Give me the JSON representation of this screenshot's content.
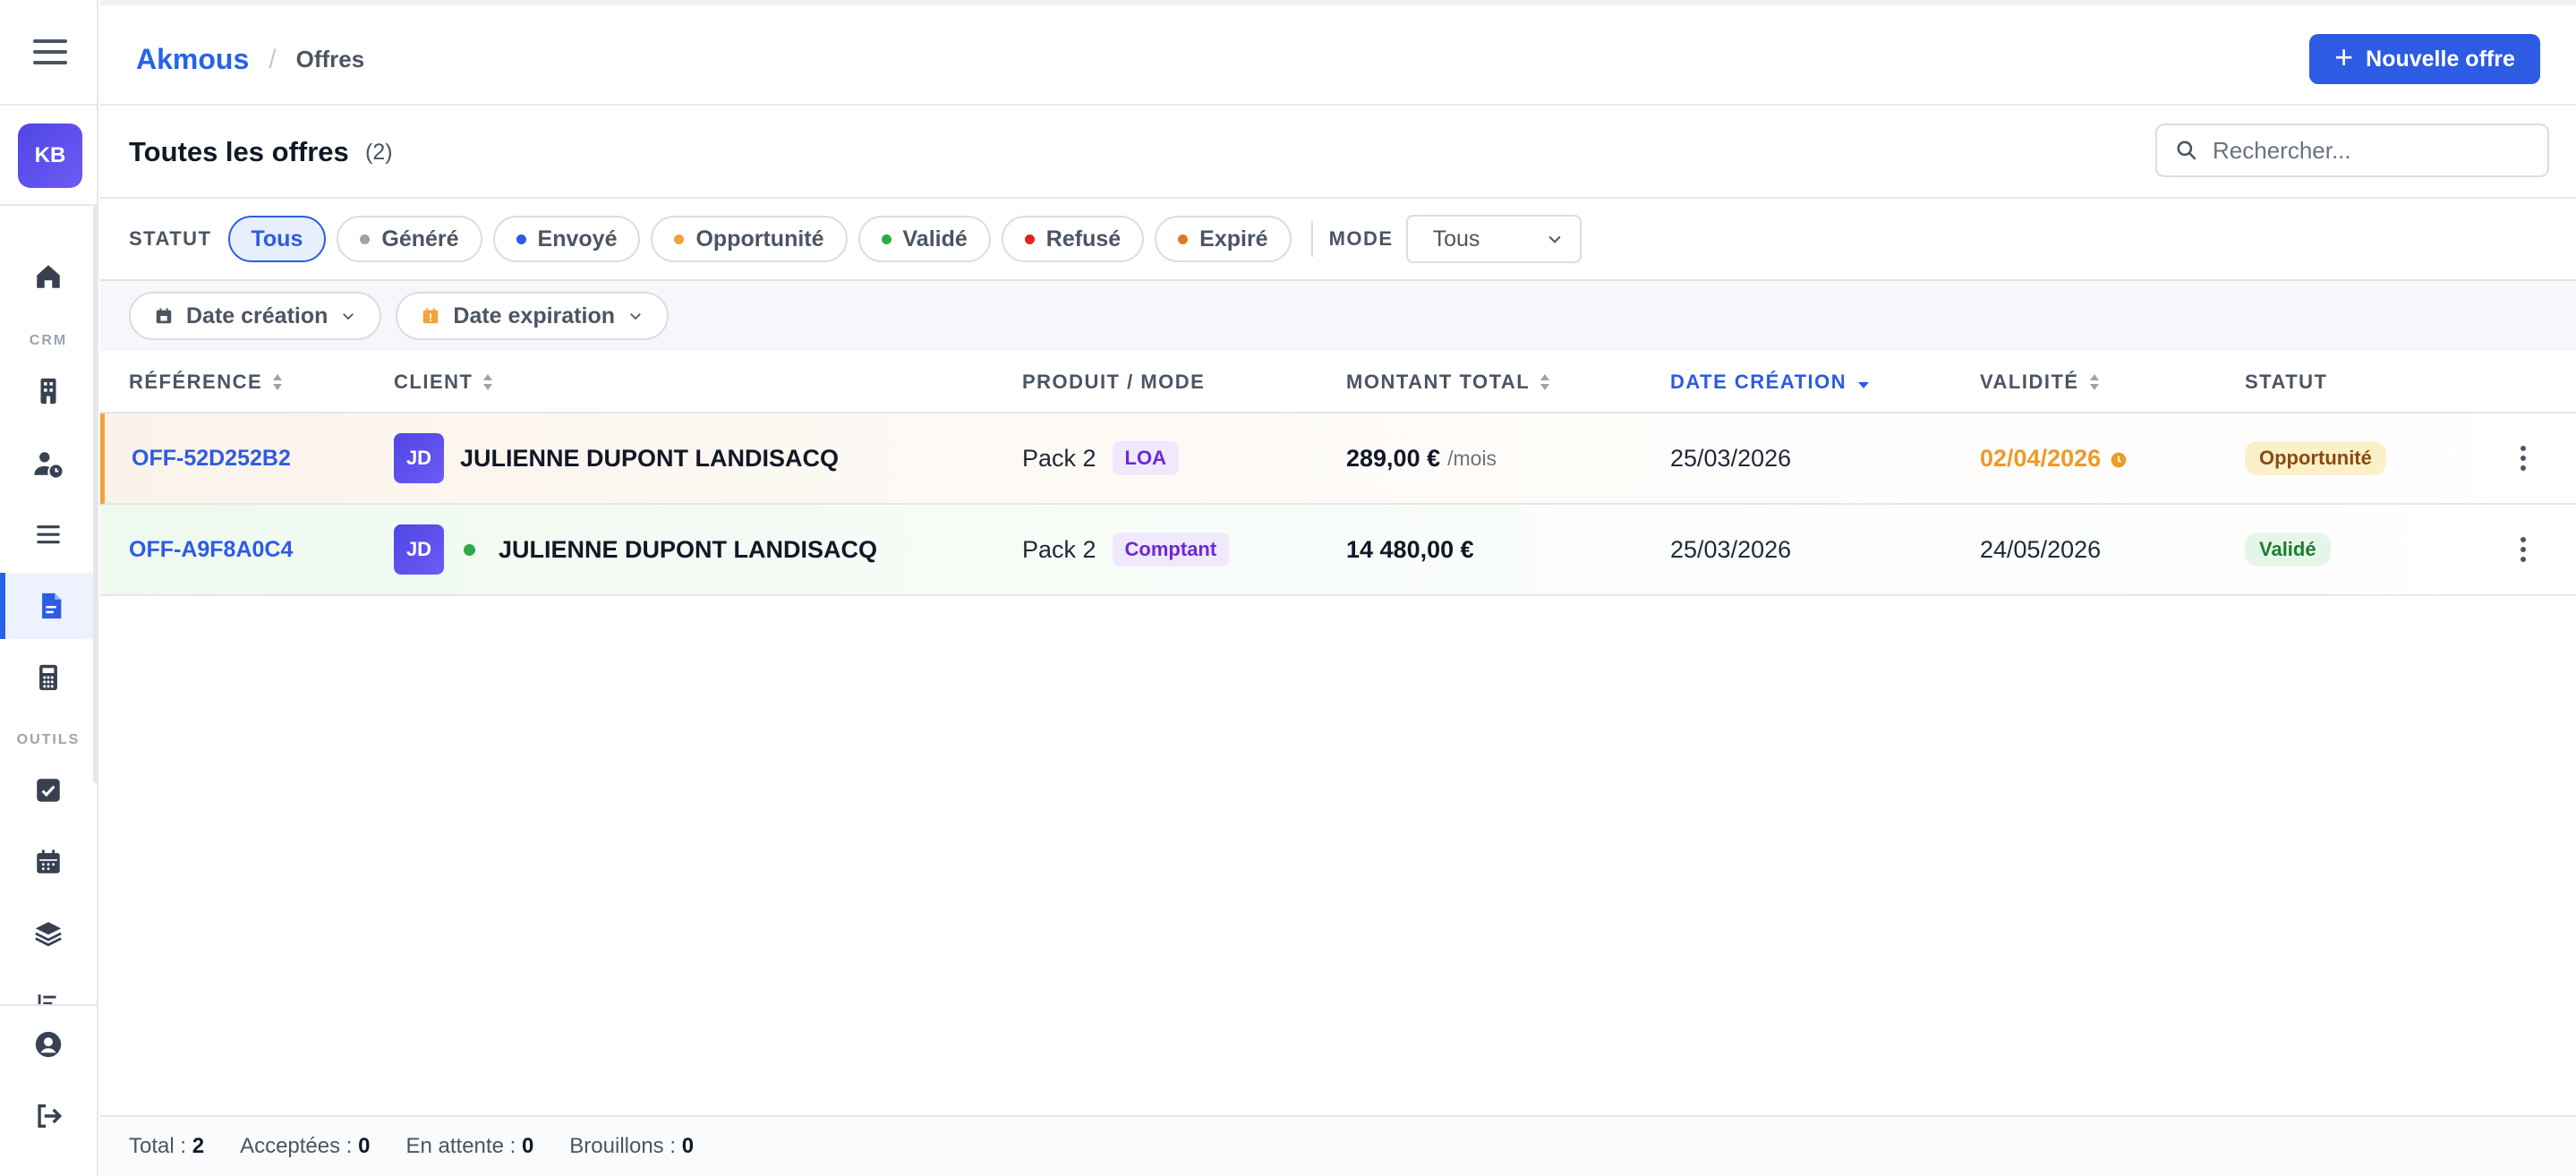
{
  "app": {
    "name": "Akmous",
    "page": "Offres"
  },
  "user": {
    "initials": "KB"
  },
  "sidebar": {
    "section_crm": "CRM",
    "section_tools": "OUTILS",
    "items": [
      {
        "icon": "home-icon"
      },
      {
        "icon": "building-icon"
      },
      {
        "icon": "user-clock-icon"
      },
      {
        "icon": "list-icon"
      },
      {
        "icon": "file-invoice-icon",
        "active": true
      },
      {
        "icon": "calculator-icon"
      },
      {
        "icon": "checkbox-icon"
      },
      {
        "icon": "calendar-icon"
      },
      {
        "icon": "layers-icon"
      },
      {
        "icon": "list-ordered-icon"
      },
      {
        "icon": "user-circle-icon"
      },
      {
        "icon": "logout-icon"
      }
    ]
  },
  "header": {
    "new_button_label": "Nouvelle offre"
  },
  "title": {
    "text": "Toutes les offres",
    "count": "(2)"
  },
  "search": {
    "placeholder": "Rechercher..."
  },
  "filters": {
    "status_label": "STATUT",
    "status_chips": [
      {
        "label": "Tous",
        "active": true
      },
      {
        "label": "Généré",
        "dot": "#9ca3af"
      },
      {
        "label": "Envoyé",
        "dot": "#2d5be3"
      },
      {
        "label": "Opportunité",
        "dot": "#f0a33c"
      },
      {
        "label": "Validé",
        "dot": "#2faa4a"
      },
      {
        "label": "Refusé",
        "dot": "#dc2626"
      },
      {
        "label": "Expiré",
        "dot": "#e07b1f"
      }
    ],
    "mode_label": "MODE",
    "mode_value": "Tous",
    "date_creation_label": "Date création",
    "date_expiration_label": "Date expiration"
  },
  "table": {
    "columns": {
      "reference": "RÉFÉRENCE",
      "client": "CLIENT",
      "product": "PRODUIT / MODE",
      "amount": "MONTANT TOTAL",
      "created": "DATE CRÉATION",
      "validity": "VALIDITÉ",
      "status": "STATUT"
    },
    "rows": [
      {
        "reference": "OFF-52D252B2",
        "client_initials": "JD",
        "client_name": "JULIENNE DUPONT LANDISACQ",
        "product": "Pack 2",
        "mode": "LOA",
        "amount": "289,00 €",
        "amount_suffix": "/mois",
        "created": "25/03/2026",
        "validity": "02/04/2026",
        "status": "Opportunité"
      },
      {
        "reference": "OFF-A9F8A0C4",
        "client_initials": "JD",
        "client_name": "JULIENNE DUPONT LANDISACQ",
        "product": "Pack 2",
        "mode": "Comptant",
        "amount": "14 480,00 €",
        "created": "25/03/2026",
        "validity": "24/05/2026",
        "status": "Validé"
      }
    ]
  },
  "footer": {
    "total_label": "Total :",
    "total_value": "2",
    "accepted_label": "Acceptées :",
    "accepted_value": "0",
    "pending_label": "En attente :",
    "pending_value": "0",
    "drafts_label": "Brouillons :",
    "drafts_value": "0"
  },
  "colors": {
    "accent": "#2d5be3",
    "warning": "#f0a33c",
    "success": "#2faa4a"
  }
}
